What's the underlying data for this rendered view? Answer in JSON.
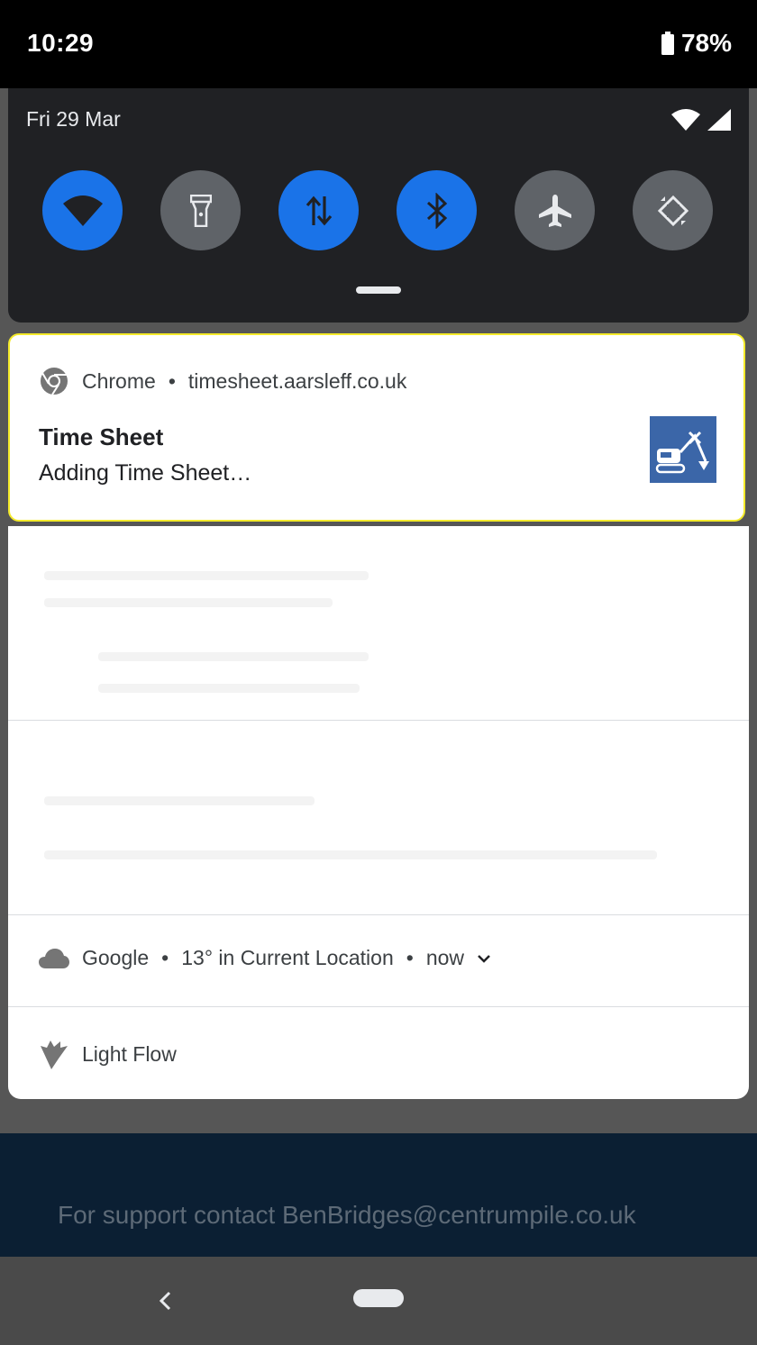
{
  "status_bar": {
    "time": "10:29",
    "battery_percent": "78%"
  },
  "quick_settings": {
    "date": "Fri 29 Mar",
    "tiles": [
      {
        "name": "wifi",
        "icon": "wifi-icon",
        "state": "on"
      },
      {
        "name": "flashlight",
        "icon": "flashlight-icon",
        "state": "off"
      },
      {
        "name": "mobile-data",
        "icon": "data-arrows-icon",
        "state": "on"
      },
      {
        "name": "bluetooth",
        "icon": "bluetooth-icon",
        "state": "on"
      },
      {
        "name": "airplane-mode",
        "icon": "airplane-icon",
        "state": "off"
      },
      {
        "name": "auto-rotate",
        "icon": "rotate-icon",
        "state": "off"
      }
    ]
  },
  "notification": {
    "app": "Chrome",
    "separator": "•",
    "source": "timesheet.aarsleff.co.uk",
    "title": "Time Sheet",
    "body": "Adding Time Sheet…"
  },
  "weather": {
    "app": "Google",
    "text": "13° in Current Location",
    "time": "now"
  },
  "lightflow": {
    "app": "Light Flow"
  },
  "background_page": {
    "footer_text": "For support contact BenBridges@centrumpile.co.uk"
  },
  "colors": {
    "accent": "#1a73e8",
    "highlight_border": "#f4ea2a",
    "panel": "#202124"
  }
}
